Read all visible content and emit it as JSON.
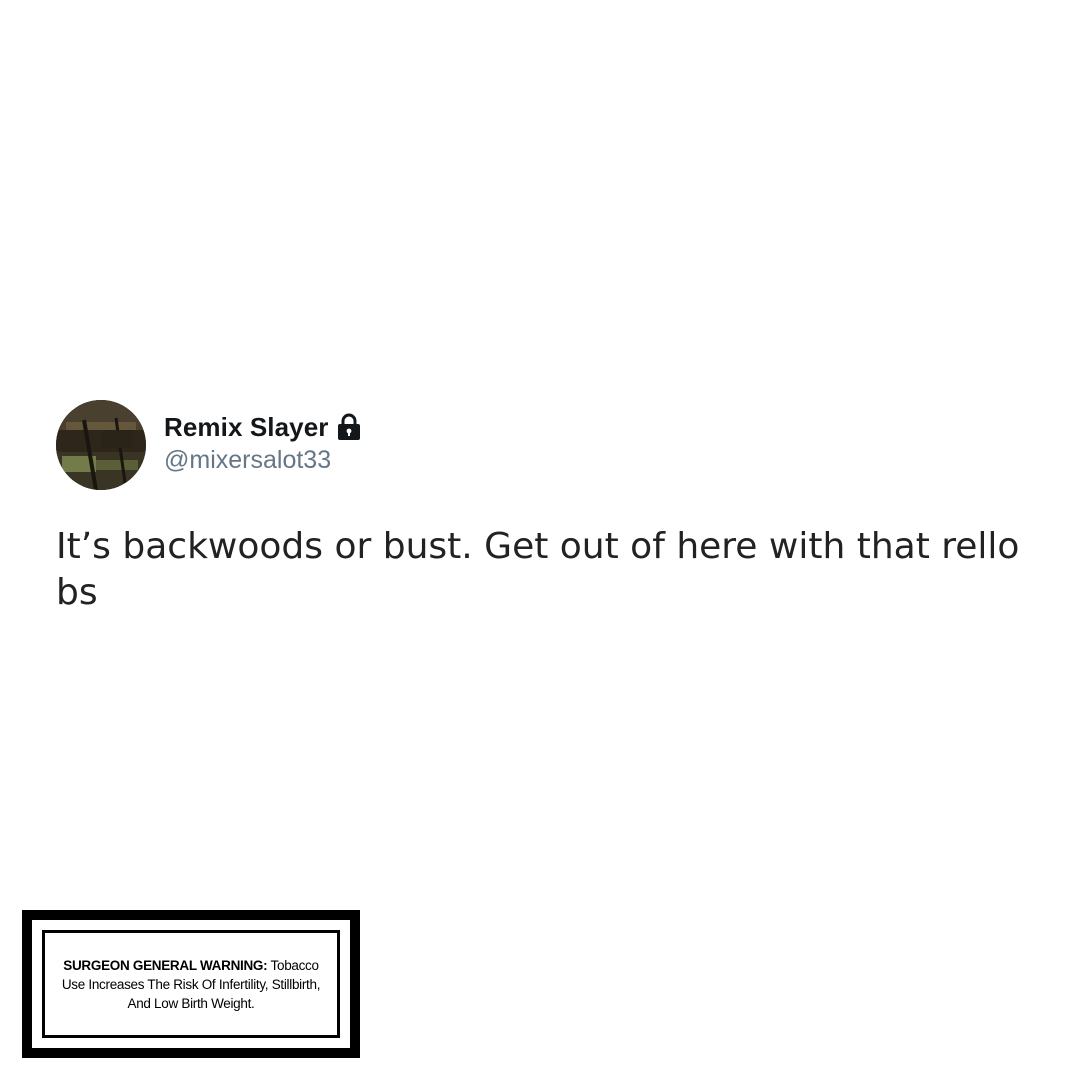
{
  "tweet": {
    "display_name": "Remix Slayer",
    "handle": "@mixersalot33",
    "verified_icon": "lock-icon",
    "text": "It’s backwoods or bust. Get out of here with that rello\nbs"
  },
  "warning": {
    "heading": "SURGEON GENERAL WARNING:",
    "body": " Tobacco Use Increases The Risk Of Infertility, Stillbirth, And Low Birth Weight."
  },
  "colors": {
    "name": "#14171a",
    "handle": "#657786",
    "text": "#222222",
    "background": "#ffffff",
    "warning_border": "#000000"
  }
}
